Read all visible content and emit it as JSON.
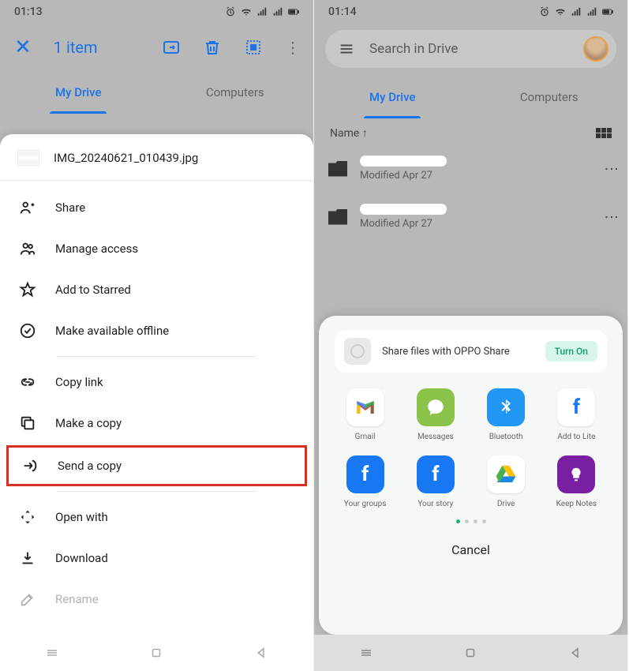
{
  "screen1": {
    "status": {
      "time": "01:13"
    },
    "selection": {
      "count_label": "1 item"
    },
    "tabs": {
      "mydrive": "My Drive",
      "computers": "Computers"
    },
    "file": {
      "name": "IMG_20240621_010439.jpg"
    },
    "menu": {
      "share": "Share",
      "manage_access": "Manage access",
      "add_starred": "Add to Starred",
      "available_offline": "Make available offline",
      "copy_link": "Copy link",
      "make_copy": "Make a copy",
      "send_copy": "Send a copy",
      "open_with": "Open with",
      "download": "Download",
      "rename": "Rename"
    }
  },
  "screen2": {
    "status": {
      "time": "01:14"
    },
    "search": {
      "placeholder": "Search in Drive"
    },
    "tabs": {
      "mydrive": "My Drive",
      "computers": "Computers"
    },
    "sort": {
      "label": "Name ↑"
    },
    "rows": [
      {
        "subtitle": "Modified Apr 27"
      },
      {
        "subtitle": "Modified Apr 27"
      }
    ],
    "share_sheet": {
      "oppo_text": "Share files with OPPO Share",
      "turn_on": "Turn On",
      "apps": [
        {
          "key": "gmail",
          "label": "Gmail"
        },
        {
          "key": "messages",
          "label": "Messages"
        },
        {
          "key": "bluetooth",
          "label": "Bluetooth"
        },
        {
          "key": "addlite",
          "label": "Add to Lite"
        },
        {
          "key": "groups",
          "label": "Your groups"
        },
        {
          "key": "story",
          "label": "Your story"
        },
        {
          "key": "drive",
          "label": "Drive"
        },
        {
          "key": "keep",
          "label": "Keep Notes"
        }
      ],
      "cancel": "Cancel"
    }
  }
}
